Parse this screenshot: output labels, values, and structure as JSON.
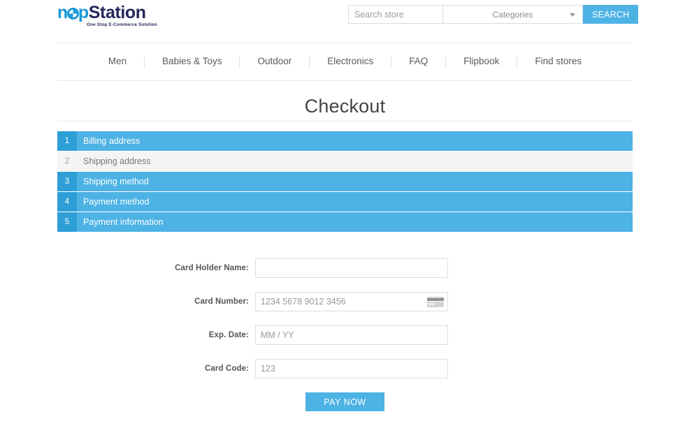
{
  "brand": {
    "logo_prefix": "n",
    "logo_suffix": "p",
    "logo_name": "Station",
    "tagline": "One Stop E-Commerce Solution",
    "accent_color": "#4db2e4",
    "accent_dark": "#2e9ed6",
    "logo_blue": "#1a9ad7",
    "logo_navy": "#23285c"
  },
  "search": {
    "placeholder": "Search store",
    "value": "",
    "category_selected": "Categories",
    "button_label": "SEARCH"
  },
  "nav": {
    "items": [
      {
        "label": "Men"
      },
      {
        "label": "Babies & Toys"
      },
      {
        "label": "Outdoor"
      },
      {
        "label": "Electronics"
      },
      {
        "label": "FAQ"
      },
      {
        "label": "Flipbook"
      },
      {
        "label": "Find stores"
      }
    ]
  },
  "page": {
    "title": "Checkout"
  },
  "steps": [
    {
      "number": "1",
      "label": "Billing address",
      "active": true
    },
    {
      "number": "2",
      "label": "Shipping address",
      "active": false
    },
    {
      "number": "3",
      "label": "Shipping method",
      "active": true
    },
    {
      "number": "4",
      "label": "Payment method",
      "active": true
    },
    {
      "number": "5",
      "label": "Payment information",
      "active": true
    }
  ],
  "payment_form": {
    "fields": [
      {
        "label": "Card Holder Name:",
        "placeholder": "",
        "value": "",
        "icon": ""
      },
      {
        "label": "Card Number:",
        "placeholder": "1234 5678 9012 3456",
        "value": "",
        "icon": "credit-card-icon"
      },
      {
        "label": "Exp. Date:",
        "placeholder": "MM / YY",
        "value": "",
        "icon": ""
      },
      {
        "label": "Card Code:",
        "placeholder": "123",
        "value": "",
        "icon": ""
      }
    ],
    "submit_label": "PAY NOW"
  }
}
